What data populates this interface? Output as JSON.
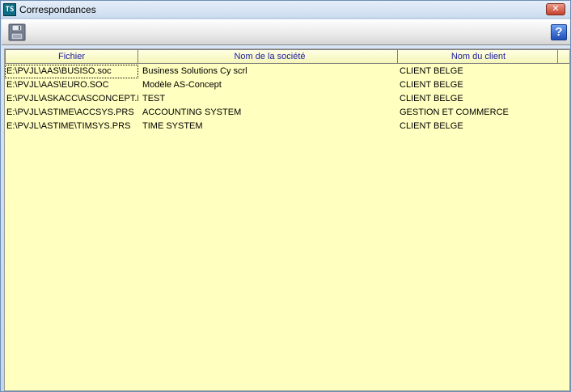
{
  "window": {
    "title": "Correspondances",
    "close_label": "✕"
  },
  "toolbar": {
    "help_label": "?"
  },
  "table": {
    "columns": [
      "Fichier",
      "Nom de la société",
      "Nom du client"
    ],
    "rows": [
      {
        "fichier": "E:\\PVJL\\AAS\\BUSISO.soc",
        "societe": "Business Solutions Cy scrl",
        "client": "CLIENT BELGE"
      },
      {
        "fichier": "E:\\PVJL\\AAS\\EURO.SOC",
        "societe": "Modèle AS-Concept",
        "client": "CLIENT BELGE"
      },
      {
        "fichier": "E:\\PVJL\\ASKACC\\ASCONCEPT.KA",
        "societe": "TEST",
        "client": "CLIENT BELGE"
      },
      {
        "fichier": "E:\\PVJL\\ASTIME\\ACCSYS.PRS",
        "societe": "ACCOUNTING SYSTEM",
        "client": "GESTION ET COMMERCE"
      },
      {
        "fichier": "E:\\PVJL\\ASTIME\\TIMSYS.PRS",
        "societe": "TIME SYSTEM",
        "client": "CLIENT BELGE"
      }
    ]
  },
  "colors": {
    "grid_background": "#ffffc0",
    "header_text": "#1a1aa0"
  },
  "icons": {
    "app": "app-logo-icon",
    "save": "floppy-disk-icon",
    "help": "help-icon",
    "close": "close-icon"
  }
}
